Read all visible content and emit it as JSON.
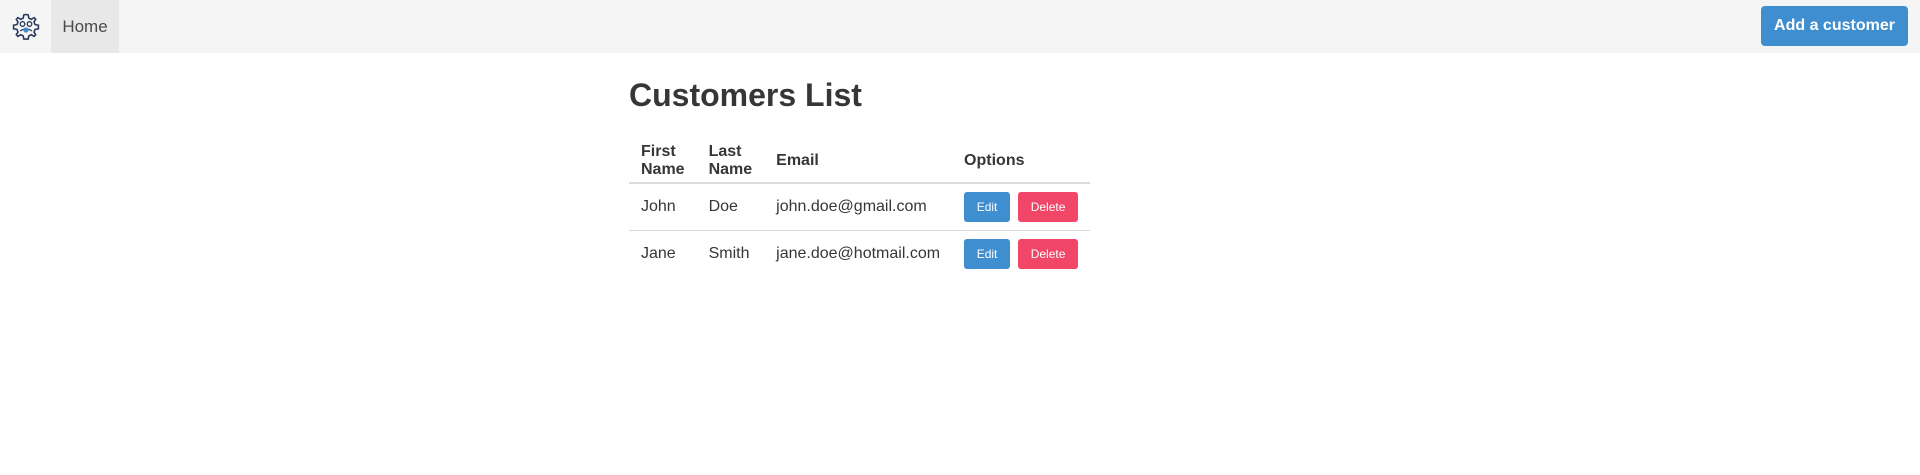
{
  "navbar": {
    "logo_icon": "gear-logo-icon",
    "home_label": "Home",
    "add_customer_label": "Add a customer"
  },
  "page": {
    "title": "Customers List"
  },
  "table": {
    "headers": [
      "First Name",
      "Last Name",
      "Email",
      "Options"
    ],
    "rows": [
      {
        "first_name": "John",
        "last_name": "Doe",
        "email": "john.doe@gmail.com",
        "edit_label": "Edit",
        "delete_label": "Delete"
      },
      {
        "first_name": "Jane",
        "last_name": "Smith",
        "email": "jane.doe@hotmail.com",
        "edit_label": "Edit",
        "delete_label": "Delete"
      }
    ]
  },
  "colors": {
    "primary": "#3e8ed0",
    "danger": "#f14668",
    "navbar_bg": "#f5f5f5",
    "text": "#363636"
  }
}
